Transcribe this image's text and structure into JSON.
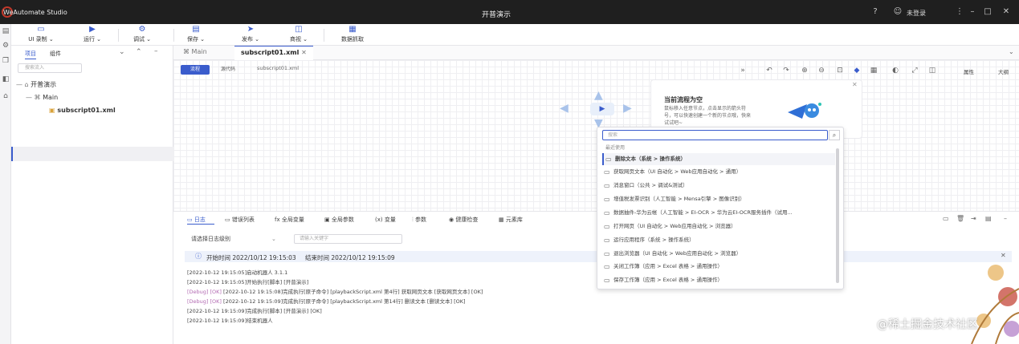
{
  "titlebar": {
    "app_name": "WeAutomate Studio",
    "window_title": "开普演示",
    "login": "未登录"
  },
  "toolbar": {
    "items": [
      {
        "label": "UI 录制",
        "icon": "▭"
      },
      {
        "label": "运行",
        "icon": "▶"
      },
      {
        "label": "调试",
        "icon": "⚙"
      },
      {
        "label": "保存",
        "icon": "▤"
      },
      {
        "label": "发布",
        "icon": "➤"
      },
      {
        "label": "商视",
        "icon": "◫"
      },
      {
        "label": "数据抓取",
        "icon": "▦"
      }
    ]
  },
  "project": {
    "tabs": [
      "项目",
      "组件"
    ],
    "search_placeholder": "搜索流入",
    "tree": {
      "root": "开普演示",
      "main": "Main",
      "file": "subscript01.xml"
    }
  },
  "editor": {
    "tabs": [
      "Main",
      "subscript01.xml"
    ],
    "views": [
      "流程",
      "源代码"
    ],
    "breadcrumb": "subscript01.xml",
    "right_labels": [
      "属性",
      "大纲"
    ]
  },
  "hint": {
    "title": "当前流程为空",
    "text": "鼠标移入任意节点，点击显示的箭头符号，可以快速创建一个新的节点哦，快来试试吧~"
  },
  "dropdown": {
    "search_placeholder": "搜索",
    "section": "最近使用",
    "items": [
      "删除文本（系统 > 操作系统）",
      "获取网页文本（UI 自动化 > Web应用自动化 > 通用）",
      "消息窗口（公共 > 调试&测试）",
      "增值税发票识别（人工智能 > Mensa引擎 > 图像识别）",
      "数据抽件-华为云帐（人工智能 > EI-OCR > 华为云EI-OCR服务插件（试用...",
      "打开网页（UI 自动化 > Web应用自动化 > 浏览器）",
      "运行应用程序（系统 > 操作系统）",
      "退出浏览器（UI 自动化 > Web应用自动化 > 浏览器）",
      "关闭工作簿（应用 > Excel 表格 > 通用操作）",
      "保存工作簿（应用 > Excel 表格 > 通用操作）"
    ]
  },
  "bottom": {
    "tabs": [
      "日志",
      "错误列表",
      "全局变量",
      "全局参数",
      "变量",
      "参数",
      "健康检查",
      "元素库"
    ],
    "level_select": "请选择日志级别",
    "filter_placeholder": "请输入关键字",
    "info": {
      "start": "开始时间 2022/10/12 19:15:03",
      "end": "结束时间 2022/10/12 19:15:09"
    },
    "logs": [
      {
        "tag": "",
        "text": "[2022-10-12 19:15:05]启动机器人 3.1.1"
      },
      {
        "tag": "",
        "text": "[2022-10-12 19:15:05]开始执行[脚本] [开普演示]"
      },
      {
        "tag": "[Debug] [OK]",
        "text": " [2022-10-12 19:15:08]完成执行[原子命令] [playbackScript.xml 第4行] 获取网页文本 [获取网页文本] [OK]"
      },
      {
        "tag": "[Debug] [OK]",
        "text": " [2022-10-12 19:15:09]完成执行[原子命令] [playbackScript.xml 第14行] 删读文本 [删读文本] [OK]"
      },
      {
        "tag": "",
        "text": "[2022-10-12 19:15:09]完成执行[脚本] [开普演示] [OK]"
      },
      {
        "tag": "",
        "text": "[2022-10-12 19:15:09]结束机器人"
      }
    ]
  },
  "watermark": "@稀土掘金技术社区",
  "colors": {
    "accent": "#3a5ccc",
    "titlebar": "#1f1f1f",
    "canvas_grid": "#efeff2"
  }
}
